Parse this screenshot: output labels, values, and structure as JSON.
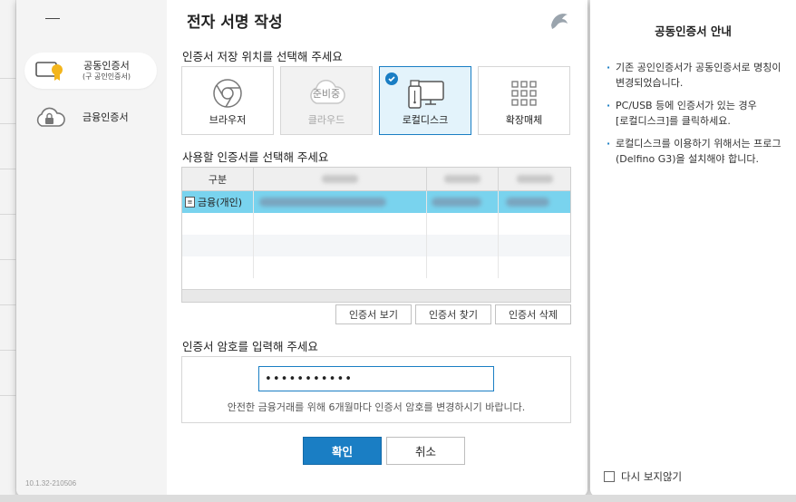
{
  "dialog": {
    "title": "전자 서명 작성",
    "version": "10.1.32-210506"
  },
  "sidebar": {
    "items": [
      {
        "label": "공동인증서",
        "sublabel": "(구 공인인증서)",
        "icon": "certificate-badge-icon",
        "active": true
      },
      {
        "label": "금융인증서",
        "sublabel": "",
        "icon": "cloud-lock-icon",
        "active": false
      }
    ]
  },
  "storage": {
    "label": "인증서 저장 위치를 선택해 주세요",
    "tiles": [
      {
        "label": "브라우저",
        "icon": "chrome-icon",
        "state": "normal"
      },
      {
        "label": "클라우드",
        "icon": "cloud-icon",
        "state": "disabled",
        "badge": "준비중"
      },
      {
        "label": "로컬디스크",
        "icon": "usb-monitor-icon",
        "state": "selected"
      },
      {
        "label": "확장매체",
        "icon": "grid-icon",
        "state": "normal"
      }
    ]
  },
  "certificates": {
    "label": "사용할 인증서를 선택해 주세요",
    "columns": [
      "구분"
    ],
    "rows": [
      {
        "type": "금융(개인)",
        "selected": true
      }
    ],
    "buttons": {
      "view": "인증서 보기",
      "find": "인증서 찾기",
      "delete": "인증서 삭제"
    }
  },
  "password": {
    "label": "인증서 암호를 입력해 주세요",
    "value": "•••••••••••",
    "hint": "안전한 금융거래를 위해 6개월마다 인증서 암호를 변경하시기 바랍니다."
  },
  "actions": {
    "ok": "확인",
    "cancel": "취소"
  },
  "info": {
    "title": "공동인증서 안내",
    "bullets": [
      {
        "line1": "기존 공인인증서가 공동인증서로 명칭이",
        "line2": "변경되었습니다."
      },
      {
        "line1": "PC/USB 등에 인증서가 있는 경우",
        "line2": "[로컬디스크]를 클릭하세요."
      },
      {
        "line1": "로컬디스크를 이용하기 위해서는 프로그",
        "line2": "(Delfino G3)을 설치해야 합니다."
      }
    ],
    "dont_show": "다시 보지않기"
  },
  "colors": {
    "accent": "#1a7ec4",
    "selected_row": "#79d3ee",
    "selected_tile": "#e3f3fb"
  }
}
